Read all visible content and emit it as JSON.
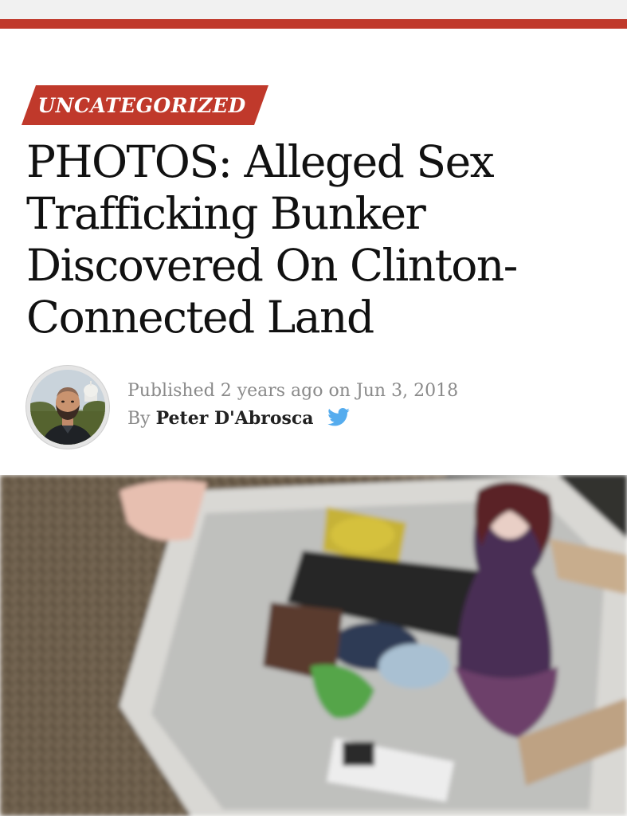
{
  "header": {
    "accent_color": "#c0392b"
  },
  "article": {
    "category": "UNCATEGORIZED",
    "headline": "PHOTOS: Alleged Sex Trafficking Bunker Discovered On Clinton-Connected Land",
    "meta": {
      "published_prefix": "Published",
      "published_relative": "2 years ago",
      "published_on": "on",
      "published_date": "Jun 3, 2018",
      "by_label": "By",
      "author": "Peter D'Abrosca",
      "social_icon": "twitter-icon"
    },
    "hero_image": {
      "icon": "photo"
    }
  }
}
